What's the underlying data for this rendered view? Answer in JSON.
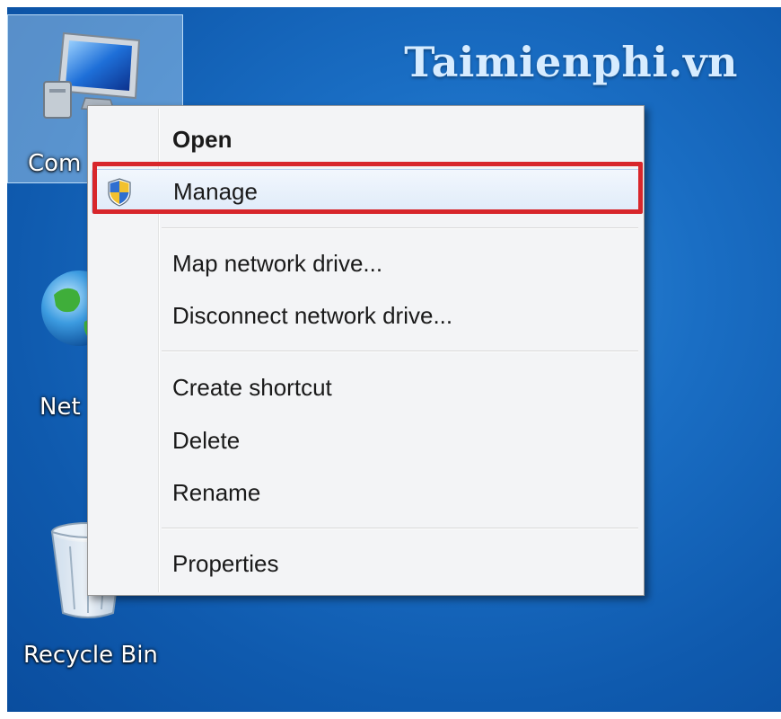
{
  "watermark": "Taimienphi.vn",
  "desktop_icons": [
    {
      "label": "Com",
      "icon": "computer-icon"
    },
    {
      "label": "Net",
      "icon": "network-globe-icon"
    },
    {
      "label": "Recycle Bin",
      "icon": "recycle-bin-icon"
    }
  ],
  "context_menu": {
    "items": [
      {
        "label": "Open",
        "bold": true
      },
      {
        "label": "Manage",
        "icon": "uac-shield-icon",
        "highlighted": true
      },
      {
        "label": "Map network drive..."
      },
      {
        "label": "Disconnect network drive..."
      },
      {
        "label": "Create shortcut"
      },
      {
        "label": "Delete"
      },
      {
        "label": "Rename"
      },
      {
        "label": "Properties"
      }
    ]
  },
  "colors": {
    "desktop_blue": "#1a6ec4",
    "highlight_red": "#d8262b",
    "menu_bg": "#f3f4f6"
  }
}
